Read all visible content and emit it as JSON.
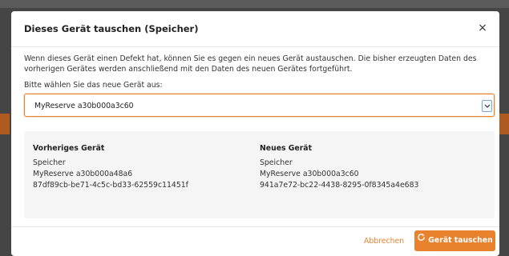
{
  "dialog": {
    "title": "Dieses Gerät tauschen (Speicher)",
    "close_symbol": "×",
    "intro": "Wenn dieses Gerät einen Defekt hat, können Sie es gegen ein neues Gerät austauschen. Die bisher erzeugten Daten des vorherigen Gerätes werden anschließend mit den Daten des neuen Gerätes fortgeführt.",
    "select_label": "Bitte wählen Sie das neue Gerät aus:",
    "select_value": "MyReserve a30b000a3c60"
  },
  "previous_device": {
    "heading": "Vorheriges Gerät",
    "type": "Speicher",
    "name": "MyReserve a30b000a48a6",
    "id": "87df89cb-be71-4c5c-bd33-62559c11451f"
  },
  "new_device": {
    "heading": "Neues Gerät",
    "type": "Speicher",
    "name": "MyReserve a30b000a3c60",
    "id": "941a7e72-bc22-4438-8295-0f8345a4e683"
  },
  "footer": {
    "cancel_label": "Abbrechen",
    "swap_label": "Gerät tauschen"
  },
  "colors": {
    "accent": "#e8822d",
    "backdrop": "#454545"
  },
  "icons": {
    "close": "close-icon",
    "dropdown": "chevron-down-icon",
    "swap": "refresh-icon"
  }
}
